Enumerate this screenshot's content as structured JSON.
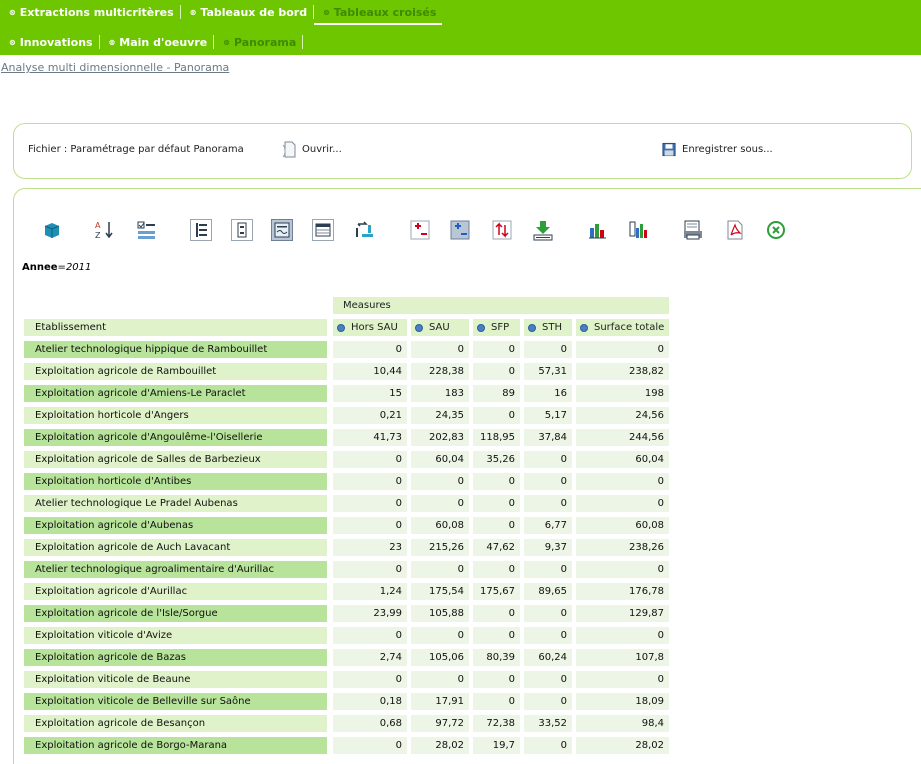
{
  "nav": {
    "row1": [
      {
        "label": "Extractions multicritères",
        "active": false
      },
      {
        "label": "Tableaux de bord",
        "active": false
      },
      {
        "label": "Tableaux croisés",
        "active": true
      }
    ],
    "row2": [
      {
        "label": "Innovations",
        "active": false
      },
      {
        "label": "Main d'oeuvre",
        "active": false
      },
      {
        "label": "Panorama",
        "active": true
      }
    ]
  },
  "breadcrumb": "Analyse multi dimensionnelle - Panorama",
  "file": {
    "label": "Fichier : Paramétrage par défaut Panorama",
    "open_label": "Ouvrir...",
    "save_label": "Enregistrer sous..."
  },
  "filter": {
    "key": "Annee",
    "value": "2011"
  },
  "table": {
    "measures_label": "Measures",
    "row_header": "Etablissement",
    "columns": [
      "Hors SAU",
      "SAU",
      "SFP",
      "STH",
      "Surface totale"
    ],
    "rows": [
      {
        "name": "Atelier technologique hippique de Rambouillet",
        "values": [
          "0",
          "0",
          "0",
          "0",
          "0"
        ]
      },
      {
        "name": "Exploitation agricole de Rambouillet",
        "values": [
          "10,44",
          "228,38",
          "0",
          "57,31",
          "238,82"
        ]
      },
      {
        "name": "Exploitation agricole d'Amiens-Le Paraclet",
        "values": [
          "15",
          "183",
          "89",
          "16",
          "198"
        ]
      },
      {
        "name": "Exploitation horticole d'Angers",
        "values": [
          "0,21",
          "24,35",
          "0",
          "5,17",
          "24,56"
        ]
      },
      {
        "name": "Exploitation agricole d'Angoulême-l'Oisellerie",
        "values": [
          "41,73",
          "202,83",
          "118,95",
          "37,84",
          "244,56"
        ]
      },
      {
        "name": "Exploitation agricole de Salles de Barbezieux",
        "values": [
          "0",
          "60,04",
          "35,26",
          "0",
          "60,04"
        ]
      },
      {
        "name": "Exploitation horticole d'Antibes",
        "values": [
          "0",
          "0",
          "0",
          "0",
          "0"
        ]
      },
      {
        "name": "Atelier technologique Le Pradel Aubenas",
        "values": [
          "0",
          "0",
          "0",
          "0",
          "0"
        ]
      },
      {
        "name": "Exploitation agricole d'Aubenas",
        "values": [
          "0",
          "60,08",
          "0",
          "6,77",
          "60,08"
        ]
      },
      {
        "name": "Exploitation agricole de Auch Lavacant",
        "values": [
          "23",
          "215,26",
          "47,62",
          "9,37",
          "238,26"
        ]
      },
      {
        "name": "Atelier technologique agroalimentaire d'Aurillac",
        "values": [
          "0",
          "0",
          "0",
          "0",
          "0"
        ]
      },
      {
        "name": "Exploitation agricole d'Aurillac",
        "values": [
          "1,24",
          "175,54",
          "175,67",
          "89,65",
          "176,78"
        ]
      },
      {
        "name": "Exploitation agricole de l'Isle/Sorgue",
        "values": [
          "23,99",
          "105,88",
          "0",
          "0",
          "129,87"
        ]
      },
      {
        "name": "Exploitation viticole d'Avize",
        "values": [
          "0",
          "0",
          "0",
          "0",
          "0"
        ]
      },
      {
        "name": "Exploitation agricole de Bazas",
        "values": [
          "2,74",
          "105,06",
          "80,39",
          "60,24",
          "107,8"
        ]
      },
      {
        "name": "Exploitation viticole de Beaune",
        "values": [
          "0",
          "0",
          "0",
          "0",
          "0"
        ]
      },
      {
        "name": "Exploitation viticole de Belleville sur Saône",
        "values": [
          "0,18",
          "17,91",
          "0",
          "0",
          "18,09"
        ]
      },
      {
        "name": "Exploitation agricole de Besançon",
        "values": [
          "0,68",
          "97,72",
          "72,38",
          "33,52",
          "98,4"
        ]
      },
      {
        "name": "Exploitation agricole de Borgo-Marana",
        "values": [
          "0",
          "28,02",
          "19,7",
          "0",
          "28,02"
        ]
      }
    ]
  },
  "toolbar": [
    {
      "name": "cube-icon",
      "pressed": false
    },
    {
      "name": "sort-az-icon",
      "pressed": false
    },
    {
      "name": "checklist-icon",
      "pressed": false
    },
    {
      "name": "expand-rows-icon",
      "pressed": false
    },
    {
      "name": "expand-columns-icon",
      "pressed": false
    },
    {
      "name": "chart-view-icon",
      "pressed": true
    },
    {
      "name": "table-view-icon",
      "pressed": false
    },
    {
      "name": "swap-axes-icon",
      "pressed": false
    },
    {
      "name": "add-red-icon",
      "pressed": false
    },
    {
      "name": "add-blue-icon",
      "pressed": false
    },
    {
      "name": "sort-updown-icon",
      "pressed": false
    },
    {
      "name": "export-download-icon",
      "pressed": false
    },
    {
      "name": "bar-chart-icon",
      "pressed": false
    },
    {
      "name": "bar-chart-table-icon",
      "pressed": false
    },
    {
      "name": "print-preview-icon",
      "pressed": false
    },
    {
      "name": "pdf-icon",
      "pressed": false
    },
    {
      "name": "excel-icon",
      "pressed": false
    }
  ]
}
